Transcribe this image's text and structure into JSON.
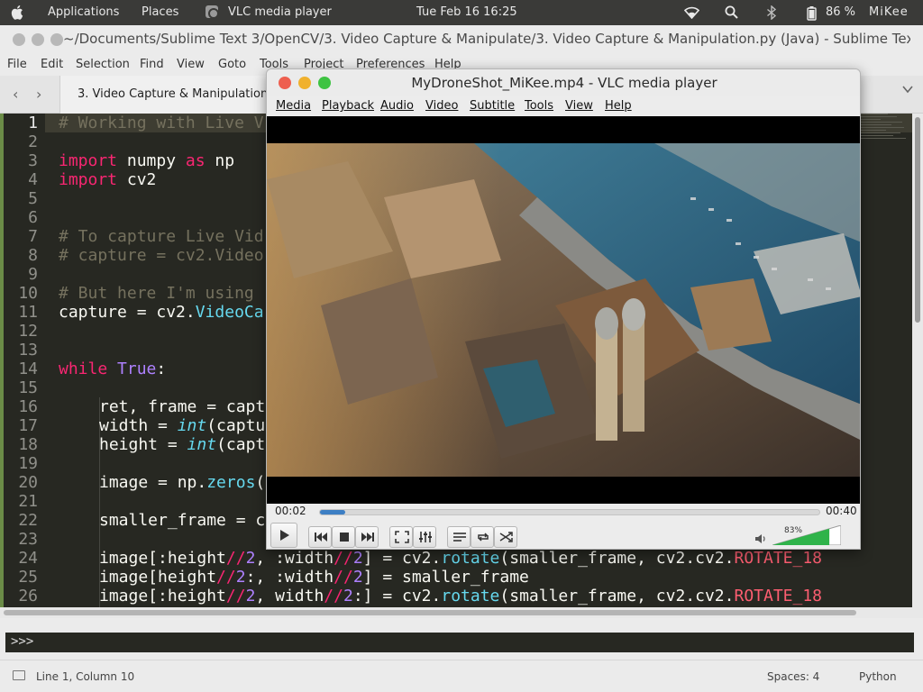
{
  "system_panel": {
    "applications": "Applications",
    "places": "Places",
    "active_app": "VLC media player",
    "datetime": "Tue Feb 16  16:25",
    "battery": "86 %",
    "user": "MiKee"
  },
  "sublime": {
    "title": "~/Documents/Sublime Text 3/OpenCV/3. Video Capture & Manipulate/3. Video Capture & Manipulation.py (Java) - Sublime Text (...",
    "menu": [
      "File",
      "Edit",
      "Selection",
      "Find",
      "View",
      "Goto",
      "Tools",
      "Project",
      "Preferences",
      "Help"
    ],
    "tab_label": "3. Video Capture & Manipulation.",
    "line_numbers": [
      "1",
      "2",
      "3",
      "4",
      "5",
      "6",
      "7",
      "8",
      "9",
      "10",
      "11",
      "12",
      "13",
      "14",
      "15",
      "16",
      "17",
      "18",
      "19",
      "20",
      "21",
      "22",
      "23",
      "24",
      "25",
      "26"
    ],
    "code": {
      "l1": "# Working with Live V",
      "l3a": "import",
      "l3b": " numpy ",
      "l3c": "as",
      "l3d": " np",
      "l4a": "import",
      "l4b": " cv2",
      "l7": "# To capture Live Vid",
      "l8": "# capture = cv2.Video",
      "l10": "# But here I'm using",
      "l11a": "capture = cv2.",
      "l11b": "VideoCa",
      "l14a": "while",
      "l14b": " True",
      "l14c": ":",
      "l16": "ret, frame = capt",
      "l17a": "width = ",
      "l17b": "int",
      "l17c": "(captu",
      "l18a": "height = ",
      "l18b": "int",
      "l18c": "(capt",
      "l20a": "image = np.",
      "l20b": "zeros",
      "l20c": "(",
      "l22": "smaller_frame = c",
      "l24a": "image[:height",
      "l24b": "//",
      "l24c": "2",
      "l24d": ", :width",
      "l24e": "//",
      "l24f": "2",
      "l24g": "] = cv2.",
      "l24h": "rotate",
      "l24i": "(smaller_frame, cv2.cv2.",
      "l24j": "ROTATE_18",
      "l25a": "image[height",
      "l25b": "//",
      "l25c": "2",
      "l25d": ":, :width",
      "l25e": "//",
      "l25f": "2",
      "l25g": "] = smaller_frame",
      "l26a": "image[:height",
      "l26b": "//",
      "l26c": "2",
      "l26d": ", width",
      "l26e": "//",
      "l26f": "2",
      "l26g": ":] = cv2.",
      "l26h": "rotate",
      "l26i": "(smaller_frame, cv2.cv2.",
      "l26j": "ROTATE_18"
    },
    "console_prompt": ">>>",
    "status_position": "Line 1, Column 10",
    "status_spaces": "Spaces: 4",
    "status_syntax": "Python"
  },
  "vlc": {
    "title": "MyDroneShot_MiKee.mp4 - VLC media player",
    "menu": [
      "Media",
      "Playback",
      "Audio",
      "Video",
      "Subtitle",
      "Tools",
      "View",
      "Help"
    ],
    "elapsed": "00:02",
    "total": "00:40",
    "progress_fraction": 0.05,
    "volume_label": "83%",
    "volume_fraction": 0.83
  },
  "colors": {
    "seek_fill": "#3d7fc4",
    "volume_fill": "#2fb34a",
    "close": "#ee5f4f",
    "minimize": "#f0b12d",
    "maximize": "#3ec342"
  }
}
